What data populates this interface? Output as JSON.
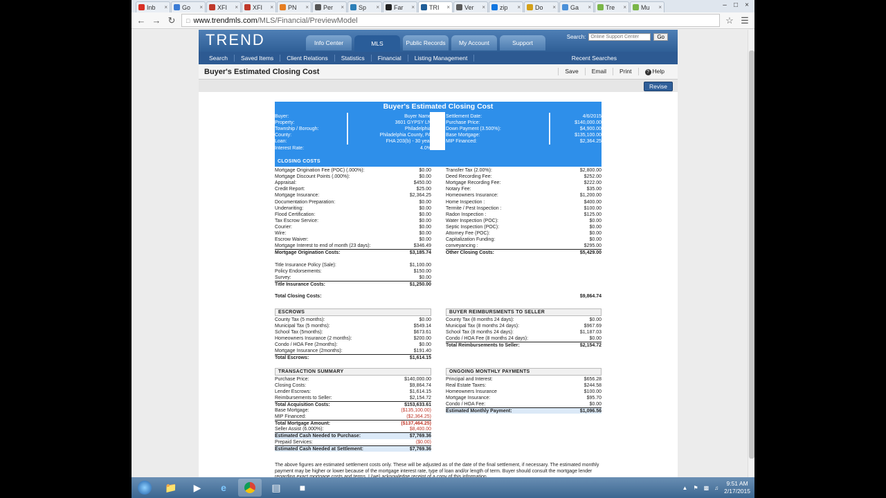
{
  "browser": {
    "tabs": [
      {
        "label": "Inb",
        "icon": "gmail-icon",
        "color": "#d93025"
      },
      {
        "label": "Go",
        "icon": "calendar-icon",
        "color": "#3a7bd5"
      },
      {
        "label": "XFI",
        "icon": "xfinity-icon",
        "color": "#c0392b"
      },
      {
        "label": "XFI",
        "icon": "xfinity-icon",
        "color": "#c0392b"
      },
      {
        "label": "PN",
        "icon": "play-icon",
        "color": "#e67e22"
      },
      {
        "label": "Per",
        "icon": "car-icon",
        "color": "#555555"
      },
      {
        "label": "Sp",
        "icon": "globe-icon",
        "color": "#2c7fb8"
      },
      {
        "label": "Far",
        "icon": "f-icon",
        "color": "#222222"
      },
      {
        "label": "TRI",
        "icon": "trend-icon",
        "color": "#1f5e99",
        "active": true
      },
      {
        "label": "Ver",
        "icon": "ver-icon",
        "color": "#5a5a5a"
      },
      {
        "label": "zip",
        "icon": "zillow-icon",
        "color": "#1277e1"
      },
      {
        "label": "Do",
        "icon": "doc-icon",
        "color": "#d4a017"
      },
      {
        "label": "Ga",
        "icon": "grid-icon",
        "color": "#4a90d9"
      },
      {
        "label": "Tre",
        "icon": "leaf-icon",
        "color": "#7ab648"
      },
      {
        "label": "Mu",
        "icon": "puzzle-icon",
        "color": "#7ab648"
      }
    ],
    "url_host": "www.trendmls.com",
    "url_path": "/MLS/Financial/PreviewModel"
  },
  "site": {
    "logo": "TREND",
    "main_tabs": [
      "Info Center",
      "MLS",
      "Public Records",
      "My Account",
      "Support"
    ],
    "active_tab": "MLS",
    "search_label": "Search:",
    "search_placeholder": "Online Support Center",
    "search_go": "Go",
    "menu": [
      "Search",
      "Saved Items",
      "Client Relations",
      "Statistics",
      "Financial",
      "Listing Management"
    ],
    "recent": "Recent Searches",
    "page_title": "Buyer's Estimated Closing Cost",
    "actions": [
      "Save",
      "Email",
      "Print",
      "Help"
    ],
    "revise": "Revise"
  },
  "report": {
    "title": "Buyer's Estimated Closing Cost",
    "header_left": [
      [
        "Buyer:",
        "Buyer Name"
      ],
      [
        "Property:",
        "3601 GYPSY LN"
      ],
      [
        "Township / Borough:",
        "Philadelphia"
      ],
      [
        "County:",
        "Philadelphia County, PA"
      ],
      [
        "Loan:",
        "FHA 203(b) - 30 year"
      ],
      [
        "Interest Rate:",
        "4.0%"
      ]
    ],
    "header_right": [
      [
        "Settlement Date:",
        "4/6/2015"
      ],
      [
        "Purchase Price:",
        "$140,000.00"
      ],
      [
        "Down Payment (3.500%):",
        "$4,900.00"
      ],
      [
        "Base Mortgage:",
        "$135,100.00"
      ],
      [
        "MIP Financed:",
        "$2,364.25"
      ]
    ],
    "closing_costs_title": "CLOSING COSTS",
    "closing_left": [
      [
        "Mortgage Origination Fee (POC) (.000%):",
        "$0.00"
      ],
      [
        "Mortgage Discount Points (.000%):",
        "$0.00"
      ],
      [
        "Appraisal:",
        "$450.00"
      ],
      [
        "Credit Report:",
        "$25.00"
      ],
      [
        "Mortgage Insurance:",
        "$2,364.25"
      ],
      [
        "Documentation Preparation:",
        "$0.00"
      ],
      [
        "Underwriting:",
        "$0.00"
      ],
      [
        "Flood Certification:",
        "$0.00"
      ],
      [
        "Tax Escrow Service:",
        "$0.00"
      ],
      [
        "Courier:",
        "$0.00"
      ],
      [
        "Wire:",
        "$0.00"
      ],
      [
        "Escrow Waiver:",
        "$0.00"
      ],
      [
        "Mortgage Interest to end of month (23 days):",
        "$346.49"
      ]
    ],
    "closing_left_total": [
      "Mortgage Origination Costs:",
      "$3,185.74"
    ],
    "closing_right": [
      [
        "Transfer Tax (2.00%):",
        "$2,800.00"
      ],
      [
        "Deed Recording Fee:",
        "$252.00"
      ],
      [
        "Mortgage Recording Fee:",
        "$222.00"
      ],
      [
        "Notary Fee:",
        "$35.00"
      ],
      [
        "Homeowners Insurance:",
        "$1,200.00"
      ],
      [
        "Home Inspection :",
        "$400.00"
      ],
      [
        "Termite / Pest Inspection :",
        "$100.00"
      ],
      [
        "Radon Inspection :",
        "$125.00"
      ],
      [
        "Water Inspection (POC):",
        "$0.00"
      ],
      [
        "Septic Inspection (POC):",
        "$0.00"
      ],
      [
        "Attorney Fee (POC):",
        "$0.00"
      ],
      [
        "Capitalization Funding:",
        "$0.00"
      ],
      [
        "conveyancing :",
        "$295.00"
      ]
    ],
    "closing_right_total": [
      "Other Closing Costs:",
      "$5,429.00"
    ],
    "title_ins": [
      [
        "Title Insurance Policy (Sale):",
        "$1,100.00"
      ],
      [
        "Policy Endorsements:",
        "$150.00"
      ],
      [
        "Survey:",
        "$0.00"
      ]
    ],
    "title_ins_total": [
      "Title Insurance Costs:",
      "$1,250.00"
    ],
    "total_closing": [
      "Total Closing Costs:",
      "$9,864.74"
    ],
    "escrows_title": "ESCROWS",
    "escrows": [
      [
        "County Tax (5 months):",
        "$0.00"
      ],
      [
        "Municipal Tax (5 months):",
        "$549.14"
      ],
      [
        "School Tax (5months):",
        "$673.61"
      ],
      [
        "Homeowners Insurance (2 months):",
        "$200.00"
      ],
      [
        "Condo / HOA Fee (2months):",
        "$0.00"
      ],
      [
        "Mortgage Insurance (2months):",
        "$191.40"
      ]
    ],
    "escrows_total": [
      "Total Escrows:",
      "$1,614.15"
    ],
    "reimb_title": "BUYER REIMBURSMENTS TO SELLER",
    "reimb": [
      [
        "County Tax (8 months 24 days):",
        "$0.00"
      ],
      [
        "Municipal Tax (8 months 24 days):",
        "$967.69"
      ],
      [
        "School Tax (8 months 24 days):",
        "$1,187.03"
      ],
      [
        "Condo / HOA Fee (8 months 24 days):",
        "$0.00"
      ]
    ],
    "reimb_total": [
      "Total Reimbursements to Seller:",
      "$2,154.72"
    ],
    "summary_title": "TRANSACTION SUMMARY",
    "summary": [
      [
        "Purchase Price:",
        "$140,000.00",
        ""
      ],
      [
        "Closing Costs:",
        "$9,864.74",
        ""
      ],
      [
        "Lender Escrows:",
        "$1,614.15",
        ""
      ],
      [
        "Reimbursements to Seller:",
        "$2,154.72",
        ""
      ],
      [
        "Total Acquisition Costs:",
        "$153,633.61",
        "bt"
      ],
      [
        "Base Mortgage:",
        "($135,100.00)",
        "n"
      ],
      [
        "MIP Financed:",
        "($2,364.25)",
        "n"
      ],
      [
        "Total Mortgage Amount:",
        "($137,464.25)",
        "btn"
      ],
      [
        "Seller Assist (6.000%):",
        "$8,400.00",
        "n"
      ],
      [
        "Estimated Cash Needed to Purchase:",
        "$7,769.36",
        "bth"
      ],
      [
        "Prepaid Services:",
        "($0.00)",
        "n"
      ],
      [
        "Estimated Cash Needed at Settlement:",
        "$7,769.36",
        "bth"
      ]
    ],
    "monthly_title": "ONGOING MONTHLY PAYMENTS",
    "monthly": [
      [
        "Principal and Interest:",
        "$656.28"
      ],
      [
        "Real Estate Taxes:",
        "$244.58"
      ],
      [
        "Homeowners Insurance",
        "$100.00"
      ],
      [
        "Mortgage Insurance:",
        "$95.70"
      ],
      [
        "Condo / HOA Fee:",
        "$0.00"
      ]
    ],
    "monthly_total": [
      "Estimated Monthly Payment:",
      "$1,096.56"
    ],
    "notice": "The above figures are estimated settlement costs only. These will be adjusted as of the date of the final settlement, if necessary. The estimated monthly payment may be higher or lower because of the mortgage interest rate, type of loan and/or length of term. Buyer should consult the mortgage lender regarding exact mortgage costs and terms. I (we) acknowledge receipt of a copy of this information."
  },
  "taskbar": {
    "time": "9:51 AM",
    "date": "2/17/2015"
  },
  "colors": {
    "header_blue": "#2e8fea",
    "nav_blue": "#2d5a92",
    "negative": "#c0392b"
  }
}
